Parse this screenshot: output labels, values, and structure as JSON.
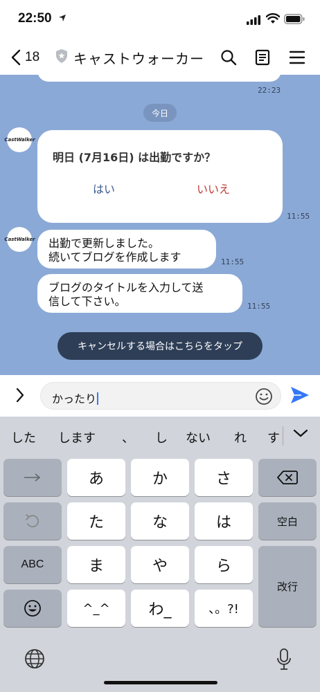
{
  "status_bar": {
    "time": "22:50"
  },
  "header": {
    "back_count": "18",
    "title": "キャストウォーカー"
  },
  "chat": {
    "prev_timestamp": "22:23",
    "date_divider": "今日",
    "card": {
      "question": "明日 (7月16日) は出勤ですか？",
      "yes_label": "はい",
      "no_label": "いいえ",
      "timestamp": "11:55"
    },
    "avatar_text": "CastWalker",
    "messages": [
      {
        "line1": "出勤で更新しました。",
        "line2": "続いてブログを作成します",
        "timestamp": "11:55"
      },
      {
        "line1": "ブログのタイトルを入力して送",
        "line2": "信して下さい。",
        "timestamp": "11:55"
      }
    ],
    "cancel_button": "キャンセルする場合はこちらをタップ"
  },
  "input": {
    "value": "かったり"
  },
  "keyboard": {
    "suggestions": [
      "した",
      "します",
      "、",
      "し",
      "ない",
      "れ",
      "す"
    ],
    "keys": {
      "a": "あ",
      "ka": "か",
      "sa": "さ",
      "ta": "た",
      "na": "な",
      "ha": "は",
      "ma": "ま",
      "ya": "や",
      "ra": "ら",
      "kaomoji": "^_^",
      "wa": "わ_",
      "punct": "、。?!",
      "space": "空白",
      "enter": "改行",
      "abc": "ABC"
    }
  },
  "colors": {
    "chat_background": "#8ba9d6",
    "send_accent": "#3478f6",
    "no_red": "#c23b34",
    "yes_blue": "#3d5a8f",
    "cancel_button_bg": "#2e3e57"
  }
}
